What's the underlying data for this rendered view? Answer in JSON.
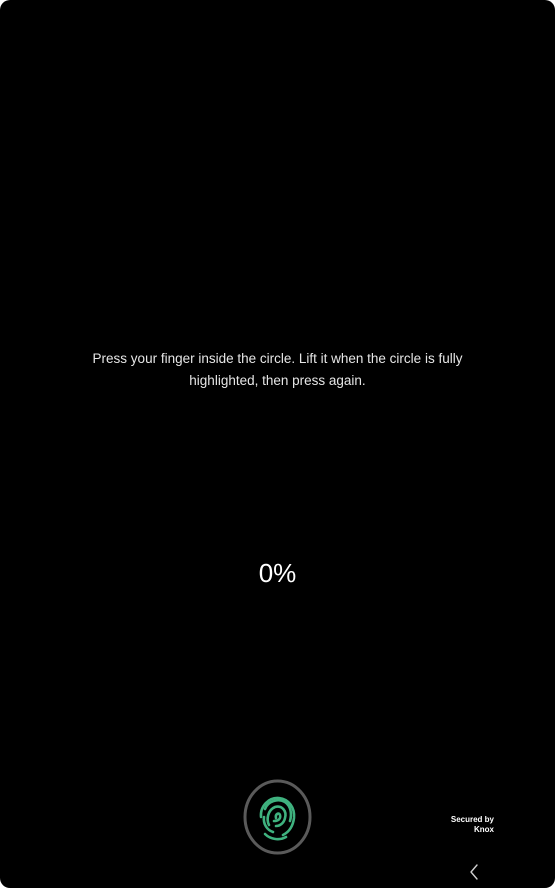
{
  "instruction": {
    "text": "Press your finger inside the circle. Lift it when the circle is fully highlighted, then press again."
  },
  "progress": {
    "label": "0%",
    "value": 0
  },
  "sensor": {
    "icon": "fingerprint-icon",
    "ring_color": "#5a5a5a",
    "icon_color": "#3fb27f"
  },
  "security": {
    "line1": "Secured by",
    "line2": "Knox"
  },
  "navigation": {
    "back_icon": "chevron-left-icon"
  }
}
